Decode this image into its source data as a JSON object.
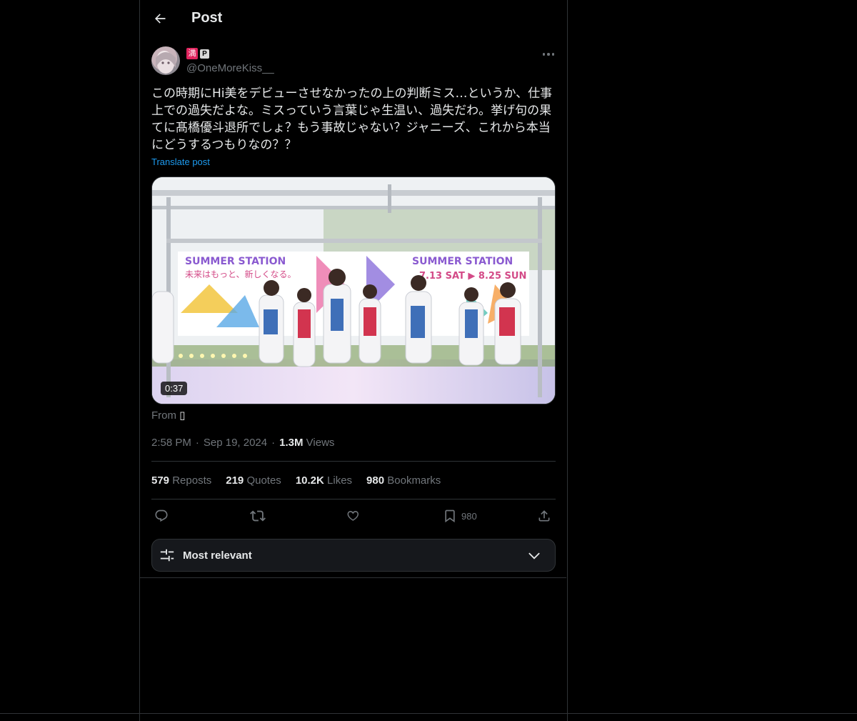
{
  "header": {
    "title": "Post"
  },
  "author": {
    "badge_1": "満",
    "badge_2": "P",
    "handle": "@OneMoreKiss__"
  },
  "post": {
    "text": "この時期にHi美をデビューさせなかったの上の判断ミス…というか、仕事上での過失だよな。ミスっていう言葉じゃ生温い、過失だわ。挙げ句の果てに髙橋優斗退所でしょ？もう事故じゃない？ジャニーズ、これから本当にどうするつもりなの？？",
    "translate_label": "Translate post",
    "media": {
      "duration": "0:37",
      "banner_left_line1": "SUMMER STATION",
      "banner_left_line2": "未来はもっと、新しくなる。",
      "banner_right_line1": "SUMMER STATION",
      "banner_right_line2": "7.13 SAT ▶ 8.25 SUN"
    },
    "from_label": "From",
    "from_glyph": "▯",
    "time": "2:58 PM",
    "separator": "·",
    "date": "Sep 19, 2024",
    "views_count": "1.3M",
    "views_label": "Views"
  },
  "stats": [
    {
      "count": "579",
      "label": "Reposts"
    },
    {
      "count": "219",
      "label": "Quotes"
    },
    {
      "count": "10.2K",
      "label": "Likes"
    },
    {
      "count": "980",
      "label": "Bookmarks"
    }
  ],
  "actions": {
    "bookmark_count": "980"
  },
  "sort": {
    "label": "Most relevant"
  },
  "icons": [
    "back-arrow-icon",
    "more-icon",
    "reply-icon",
    "repost-icon",
    "like-icon",
    "bookmark-icon",
    "share-icon",
    "sliders-icon",
    "chevron-down-icon"
  ],
  "colors": {
    "background": "#000000",
    "text": "#e7e9ea",
    "secondary": "#71767b",
    "link": "#1d9bf0",
    "border": "#2f3336"
  }
}
